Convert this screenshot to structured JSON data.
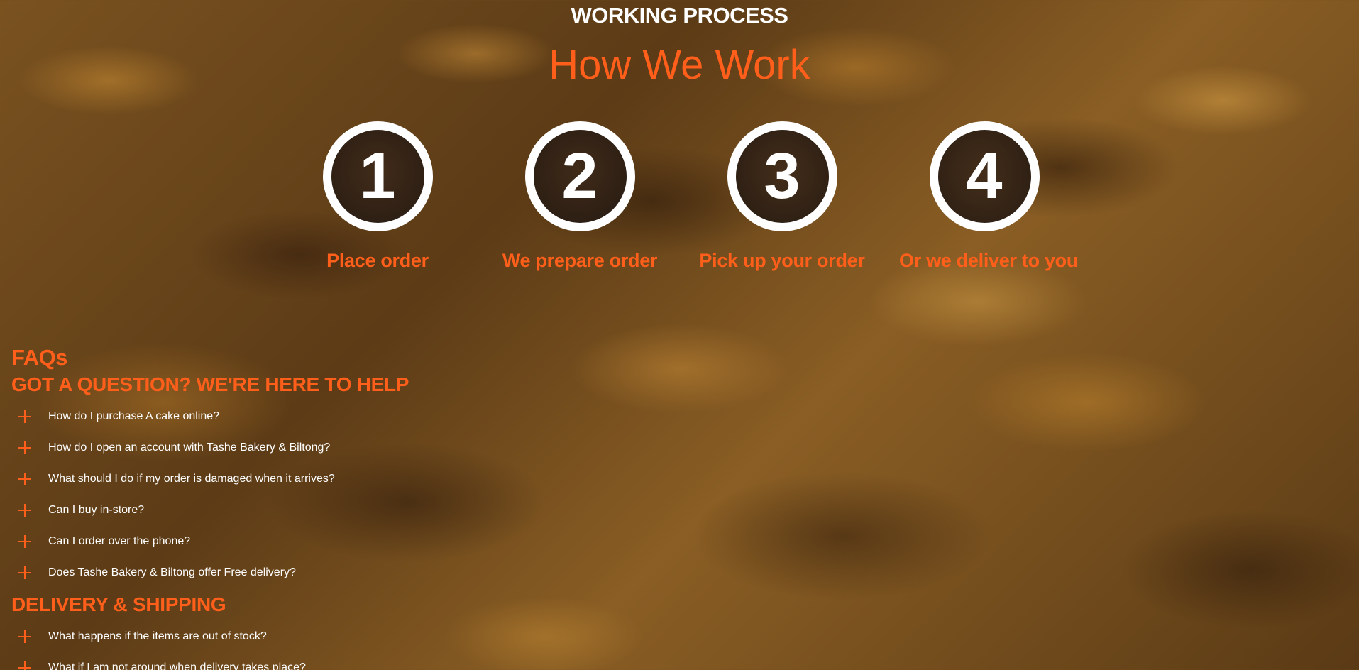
{
  "process": {
    "kicker": "WORKING PROCESS",
    "title": "How We Work",
    "steps": [
      {
        "number": "1",
        "label": "Place order"
      },
      {
        "number": "2",
        "label": "We prepare order"
      },
      {
        "number": "3",
        "label": "Pick up your order"
      },
      {
        "number": "4",
        "label": "Or we deliver to you"
      }
    ]
  },
  "faqs": {
    "title": "FAQs",
    "sections": [
      {
        "heading": "GOT A QUESTION? WE'RE HERE TO HELP",
        "questions": [
          "How do I purchase A cake online?",
          "How do I open an account with Tashe Bakery & Biltong?",
          "What should I do if my order is damaged when it arrives?",
          "Can I buy in-store?",
          "Can I order over the phone?",
          "Does Tashe Bakery & Biltong offer Free delivery?"
        ]
      },
      {
        "heading": "DELIVERY & SHIPPING",
        "questions": [
          "What happens if the items are out of stock?",
          "What if I am not around when delivery takes place?"
        ]
      }
    ]
  },
  "colors": {
    "accent": "#ff5f1a",
    "text_light": "#ffffff",
    "background": "#6e4a1c"
  }
}
